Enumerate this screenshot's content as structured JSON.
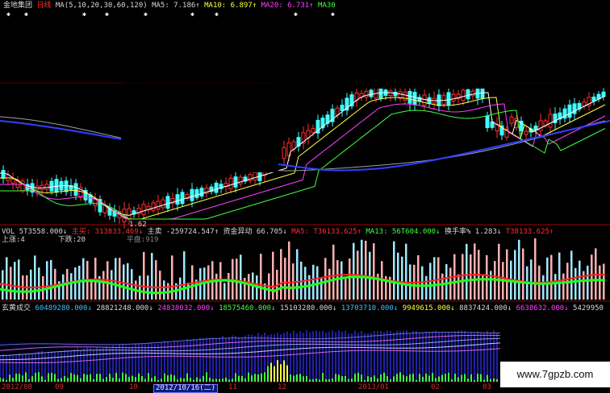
{
  "header": {
    "stock_name": "金地集团",
    "period": "日线",
    "ma_def": "MA(5,10,20,30,60,120)",
    "ma5": "MA5: 7.186↑",
    "ma10": "MA10: 6.897↑",
    "ma20": "MA20: 6.731↑",
    "ma30": "MA30"
  },
  "price_panel": {
    "low_label": "1.62"
  },
  "volume_panel": {
    "vol": "VOL 5T3558.000↓",
    "main_buy": "主买: 313833.469↓",
    "main_sell_label": "主卖",
    "main_sell": "-259724.547↑",
    "fund_label": "资金异动",
    "fund_value": "66.705↓",
    "ma5": "MA5: T36133.625↑",
    "ma13": "MA13: 56T604.000↓",
    "turnover_label": "换手率%",
    "turnover_value": "1.283↓",
    "turnover_t": "T38133.625↑",
    "rise": "上涨:4",
    "fall": "下跌:20",
    "flat": "平盘:919"
  },
  "indicator_panel": {
    "name": "玄黄成交",
    "v1": "60489280.000↓",
    "v2": "28821248.000↓",
    "v3": "24838032.000↓",
    "v4": "18575460.000↓",
    "v5": "15103280.000↓",
    "v6": "13703710.000↓",
    "v7": "9949615.000↓",
    "v8": "8837424.000↓",
    "v9": "6638632.000↓",
    "v10": "5429950"
  },
  "date_axis": {
    "labels": [
      "2012/08",
      "09",
      "10",
      "2012/10/16(二)",
      "11",
      "12",
      "2013/01",
      "02",
      "03"
    ],
    "selected": "2012/10/16(二)"
  },
  "watermark": "www.7gpzb.com",
  "colors": {
    "up": "#ff3030",
    "down": "#40ffff",
    "ma5": "#ffffff",
    "ma10": "#ffff40",
    "ma20": "#ff40ff",
    "ma30": "#40ff40",
    "ma120": "#3040ff",
    "separator": "#a00000"
  }
}
